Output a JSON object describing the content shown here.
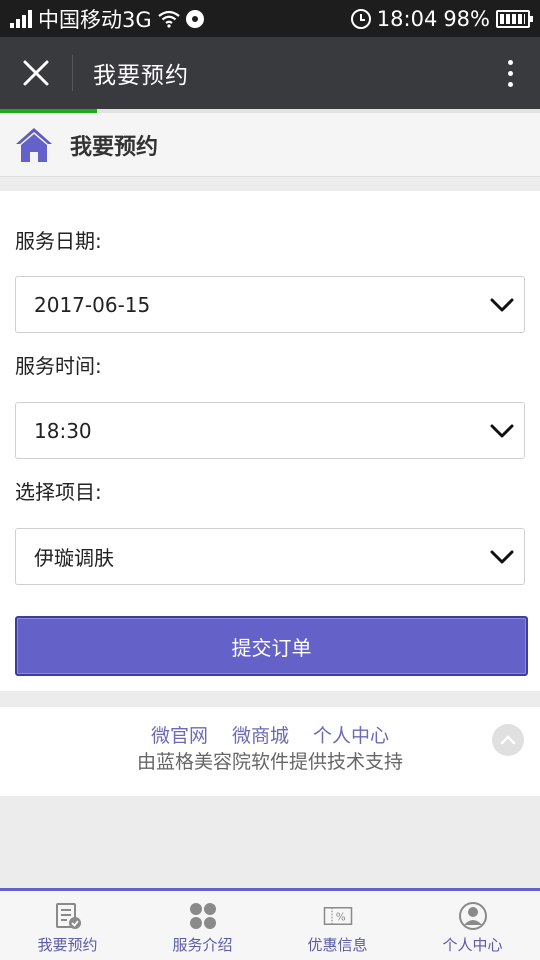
{
  "status_bar": {
    "carrier": "中国移动3G",
    "time": "18:04",
    "battery": "98%"
  },
  "title_bar": {
    "title": "我要预约",
    "page_progress": 0.18
  },
  "page_header": {
    "title": "我要预约"
  },
  "form": {
    "date_label": "服务日期:",
    "date_value": "2017-06-15",
    "time_label": "服务时间:",
    "time_value": "18:30",
    "project_label": "选择项目:",
    "project_value": "伊璇调肤",
    "submit_label": "提交订单"
  },
  "footer": {
    "links": [
      "微官网",
      "微商城",
      "个人中心"
    ],
    "support": "由蓝格美容院软件提供技术支持"
  },
  "bottom_nav": [
    {
      "label": "我要预约",
      "icon": "booking-icon"
    },
    {
      "label": "服务介绍",
      "icon": "grid-icon"
    },
    {
      "label": "优惠信息",
      "icon": "coupon-icon"
    },
    {
      "label": "个人中心",
      "icon": "user-icon"
    }
  ],
  "colors": {
    "accent": "#6462c8",
    "titlebar": "#393a3e",
    "statusbar": "#1d1d1d",
    "progress": "#1aad19"
  }
}
